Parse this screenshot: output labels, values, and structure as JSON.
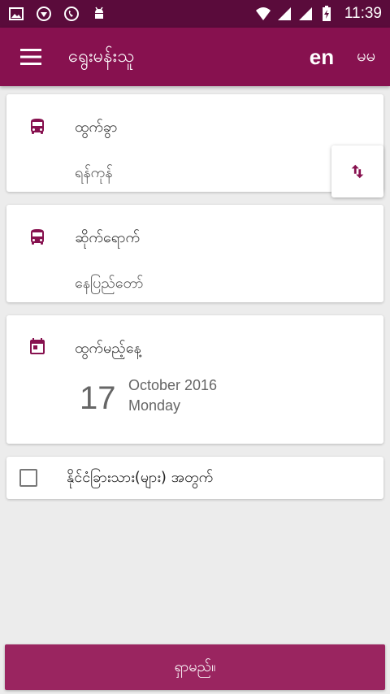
{
  "status_bar": {
    "time": "11:39",
    "icons": [
      "image-icon",
      "shield-icon",
      "phone-icon",
      "android-icon",
      "wifi-icon",
      "signal-icon",
      "signal-icon",
      "battery-charging-icon"
    ]
  },
  "app_bar": {
    "title": "ရွေးမန်းသူ",
    "lang_en": "en",
    "lang_mm": "မမ"
  },
  "from": {
    "label": "ထွက်ခွာ",
    "value": "ရန်ကုန်"
  },
  "to": {
    "label": "ဆိုက်ရောက်",
    "value": "နေပြည်တော်"
  },
  "date": {
    "label": "ထွက်မည့်နေ့",
    "day": "17",
    "month_year": "October 2016",
    "weekday": "Monday"
  },
  "foreigner": {
    "label": "နိုင်ငံခြားသား(များ) အတွက်",
    "checked": false
  },
  "search": {
    "label": "ရှာမည်။"
  },
  "colors": {
    "primary": "#87114f",
    "primary_dark": "#5a0b3b",
    "button": "#9a2560"
  }
}
